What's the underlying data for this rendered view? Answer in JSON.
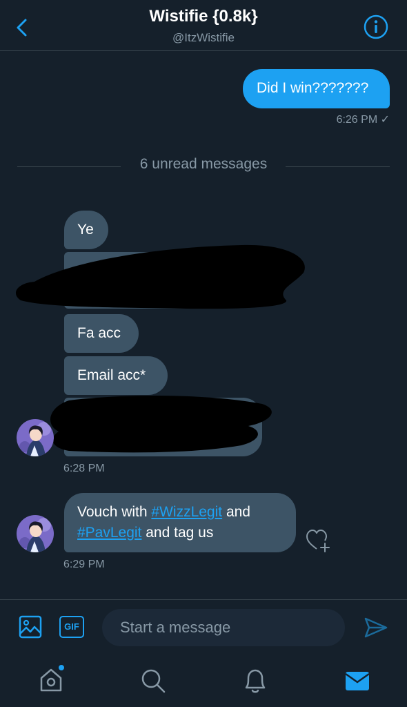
{
  "header": {
    "title": "Wistifie {0.8k}",
    "handle": "@ItzWistifie"
  },
  "messages": {
    "outgoing": {
      "text": "Did I win???????",
      "time": "6:26 PM ✓"
    },
    "unread_divider": "6 unread messages",
    "incoming_group_1": {
      "ye": "Ye",
      "fa_acc": "Fa acc",
      "email_acc": "Email acc*",
      "time": "6:28 PM"
    },
    "incoming_group_2": {
      "line1_prefix": "Vouch with ",
      "hashtag1": "#WizzLegit",
      "line1_suffix": " and",
      "hashtag2": "#PavLegit",
      "line2_suffix": " and tag us",
      "time": "6:29 PM"
    }
  },
  "composer": {
    "placeholder": "Start a message",
    "gif_label": "GIF"
  },
  "colors": {
    "background": "#15202b",
    "accent": "#1da1f2",
    "incoming_bubble": "#3d5466",
    "muted_text": "#8899a6"
  }
}
